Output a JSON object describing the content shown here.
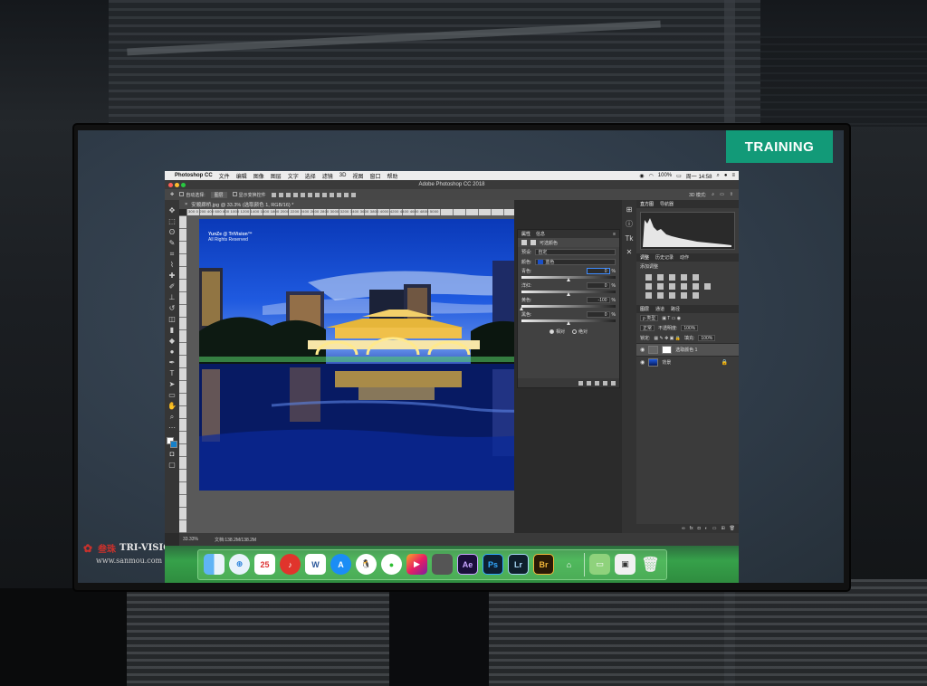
{
  "presentation": {
    "badge": "TRAINING",
    "brand_cn": "叁珠",
    "brand_en": "TRI-VISION",
    "brand_url": "www.sanmou.com"
  },
  "menubar": {
    "app_name": "Photoshop CC",
    "items": [
      "文件",
      "编辑",
      "图像",
      "图层",
      "文字",
      "选择",
      "滤镜",
      "3D",
      "视图",
      "窗口",
      "帮助"
    ],
    "battery": "100%",
    "clock": "周一 14:58"
  },
  "window": {
    "title": "Adobe Photoshop CC 2018"
  },
  "options_bar": {
    "auto_select_label": "自动选择:",
    "auto_select_value": "图层",
    "show_transform_label": "显示变换控件",
    "mode_label": "3D 模式:"
  },
  "document": {
    "tab_title": "安顺廊桥.jpg @ 33.3% (选取颜色 1, RGB/16) *",
    "ruler_numbers": "300  0  200  400  600  800  1000  1200  1400  1600  1800  2000  2200  2400  2600  2800  3000  3200  3400  3600  3800  4000  4200  4400  4600  4800  5000",
    "watermark_line1": "YunZe @ TriVision™",
    "watermark_line2": "All Rights Reserved",
    "zoom": "33.33%",
    "doc_size": "文档:138.2M/138.2M"
  },
  "properties": {
    "tabs": [
      "属性",
      "信息"
    ],
    "header": "可选颜色",
    "preset_label": "预设:",
    "preset_value": "自定",
    "colors_label": "颜色:",
    "colors_value": "蓝色",
    "sliders": [
      {
        "label": "青色:",
        "value": "0",
        "unit": "%",
        "pos": 0.5,
        "focus": true
      },
      {
        "label": "洋红:",
        "value": "0",
        "unit": "%",
        "pos": 0.5,
        "focus": false
      },
      {
        "label": "黄色:",
        "value": "-100",
        "unit": "%",
        "pos": 0.0,
        "focus": false
      },
      {
        "label": "黑色:",
        "value": "0",
        "unit": "%",
        "pos": 0.5,
        "focus": false
      }
    ],
    "radio_relative": "相对",
    "radio_absolute": "绝对"
  },
  "panels": {
    "top_tabs": [
      "直方图",
      "导航器"
    ],
    "mid_tabs": [
      "调整",
      "历史记录",
      "动作"
    ],
    "adjust_title": "添加调整",
    "layers_tabs": [
      "图层",
      "通道",
      "路径"
    ],
    "kind_filter": "ρ 类型",
    "blend_mode": "正常",
    "opacity_label": "不透明度:",
    "opacity_value": "100%",
    "lock_label": "锁定:",
    "fill_label": "填充:",
    "fill_value": "100%",
    "layers": [
      {
        "name": "选取颜色 1",
        "type": "adjustment",
        "selected": true
      },
      {
        "name": "背景",
        "type": "image",
        "selected": false
      }
    ]
  },
  "dock": {
    "icons": [
      {
        "name": "finder",
        "label": ""
      },
      {
        "name": "safari",
        "label": "⊕"
      },
      {
        "name": "calendar",
        "label": "25"
      },
      {
        "name": "netease-music",
        "label": "♪"
      },
      {
        "name": "word",
        "label": "W"
      },
      {
        "name": "app-store",
        "label": "A"
      },
      {
        "name": "qq",
        "label": "🐧"
      },
      {
        "name": "wechat",
        "label": "●"
      },
      {
        "name": "final-cut",
        "label": "▶"
      },
      {
        "name": "photo",
        "label": ""
      },
      {
        "name": "after-effects",
        "label": "Ae"
      },
      {
        "name": "photoshop",
        "label": "Ps"
      },
      {
        "name": "lightroom",
        "label": "Lr"
      },
      {
        "name": "bridge",
        "label": "Br"
      },
      {
        "name": "keynote",
        "label": "⌂"
      },
      {
        "name": "folder",
        "label": "▭"
      },
      {
        "name": "preview",
        "label": "▣"
      },
      {
        "name": "trash",
        "label": "🗑"
      }
    ]
  }
}
